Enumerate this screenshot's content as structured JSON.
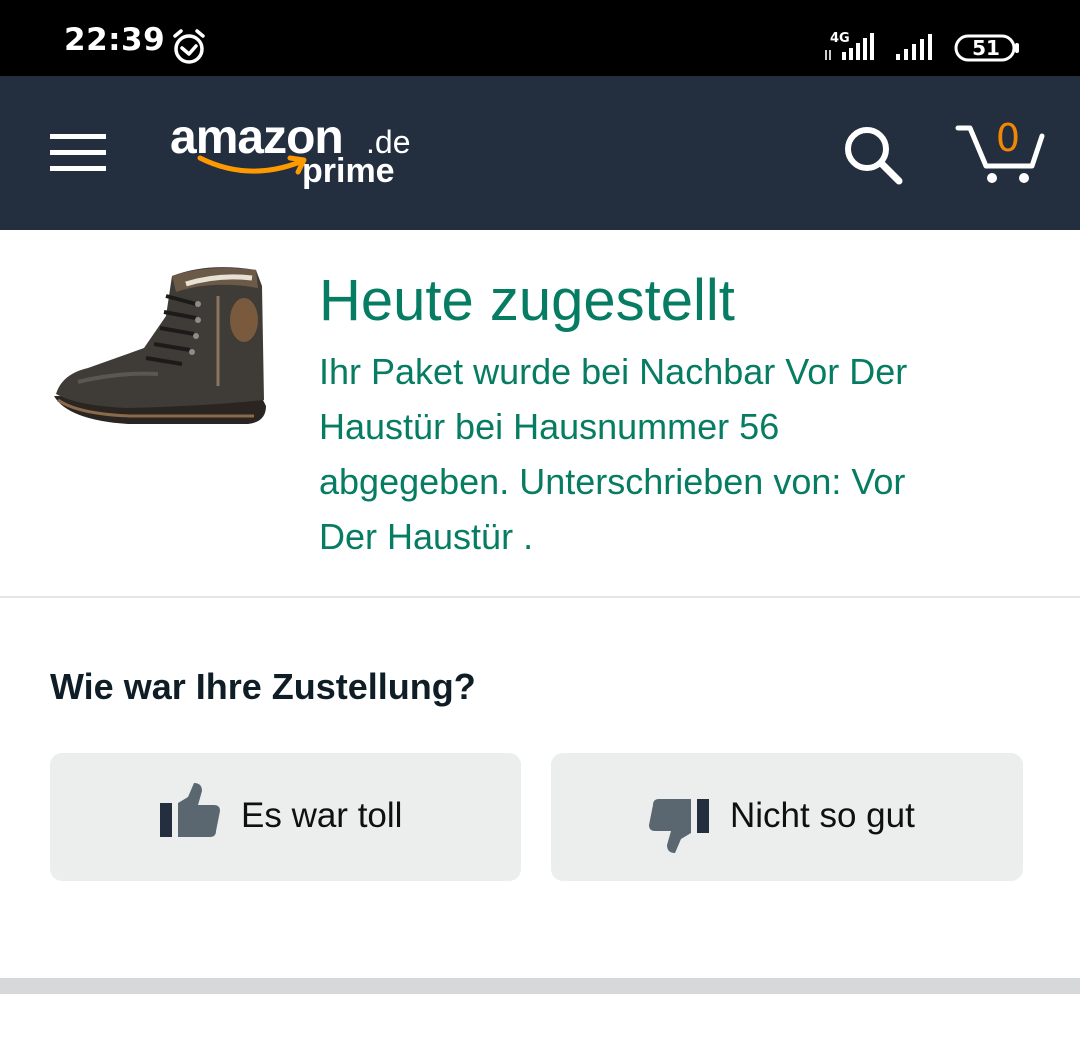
{
  "status_bar": {
    "time": "22:39",
    "network_label": "4G",
    "battery": "51",
    "icons": [
      "alarm-icon",
      "signal-4g-icon",
      "signal-icon",
      "battery-icon"
    ]
  },
  "header": {
    "logo_main": "amazon",
    "logo_domain": ".de",
    "logo_sub": "prime",
    "cart_count": "0",
    "icons": [
      "menu-icon",
      "search-icon",
      "cart-icon"
    ],
    "colors": {
      "background": "#232f3e",
      "cart_count": "#f08804"
    }
  },
  "delivery": {
    "title": "Heute zugestellt",
    "message": "Ihr Paket wurde bei Nachbar Vor Der Haustür bei Hausnummer 56 abgegeben. Unterschrieben von: Vor Der Haustür .",
    "color": "#067d62"
  },
  "feedback": {
    "question": "Wie war Ihre Zustellung?",
    "good_label": "Es war toll",
    "bad_label": "Nicht so gut",
    "icons": [
      "thumbs-up-icon",
      "thumbs-down-icon"
    ]
  }
}
